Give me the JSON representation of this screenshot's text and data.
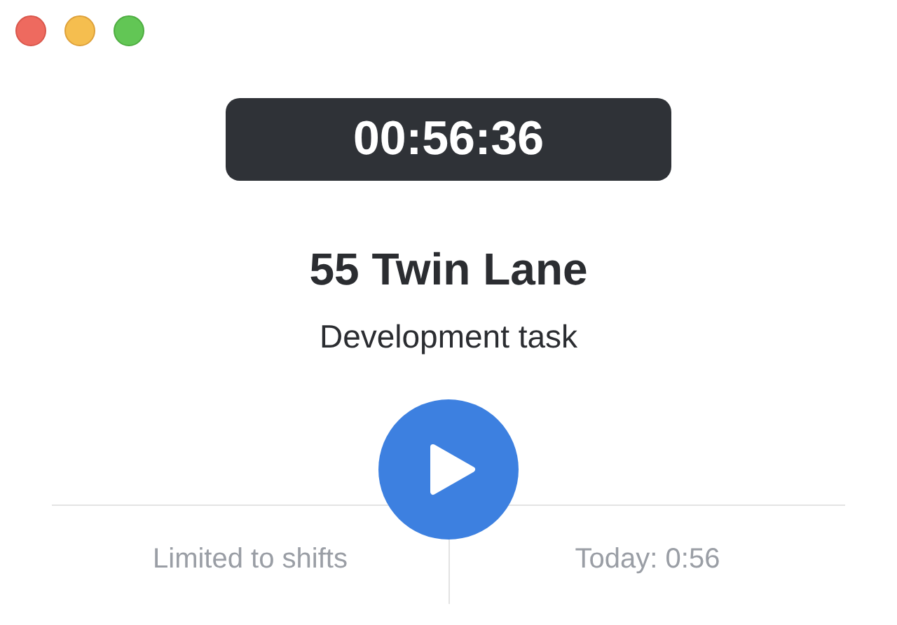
{
  "timer": "00:56:36",
  "task": {
    "title": "55 Twin Lane",
    "subtitle": "Development task"
  },
  "footer": {
    "left": "Limited to shifts",
    "right": "Today: 0:56"
  }
}
